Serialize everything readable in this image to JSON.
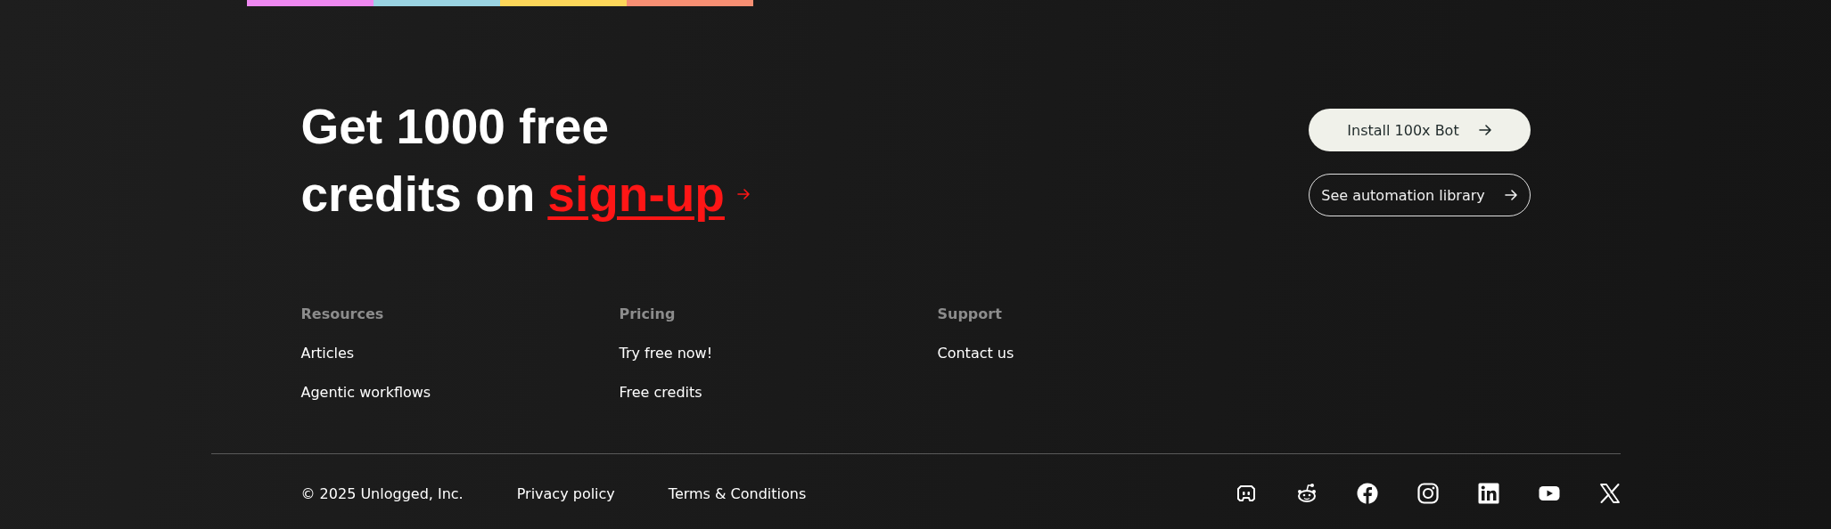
{
  "color_bar": [
    {
      "color": "#ee88f0"
    },
    {
      "color": "#9ad3e2"
    },
    {
      "color": "#fdd75a"
    },
    {
      "color": "#f78f73"
    }
  ],
  "cta": {
    "heading_line_1": "Get 1000 free",
    "heading_line_2": "credits on",
    "link": "sign-up",
    "buttons": [
      {
        "label": "Install 100x Bot",
        "kind": "filled"
      },
      {
        "label": "See automation library",
        "kind": "outline"
      }
    ]
  },
  "columns": [
    {
      "heading": "Resources",
      "links": [
        "Articles",
        "Agentic workflows"
      ]
    },
    {
      "heading": "Pricing",
      "links": [
        "Try free now!",
        "Free credits"
      ]
    },
    {
      "heading": "Support",
      "links": [
        "Contact us"
      ]
    }
  ],
  "footer": {
    "copyright": "© 2025 Unlogged, Inc.",
    "links": [
      "Privacy policy",
      "Terms & Conditions"
    ],
    "social": [
      {
        "kind": "discord"
      },
      {
        "kind": "reddit"
      },
      {
        "kind": "facebook"
      },
      {
        "kind": "instagram"
      },
      {
        "kind": "linkedin"
      },
      {
        "kind": "youtube"
      },
      {
        "kind": "x"
      }
    ]
  }
}
